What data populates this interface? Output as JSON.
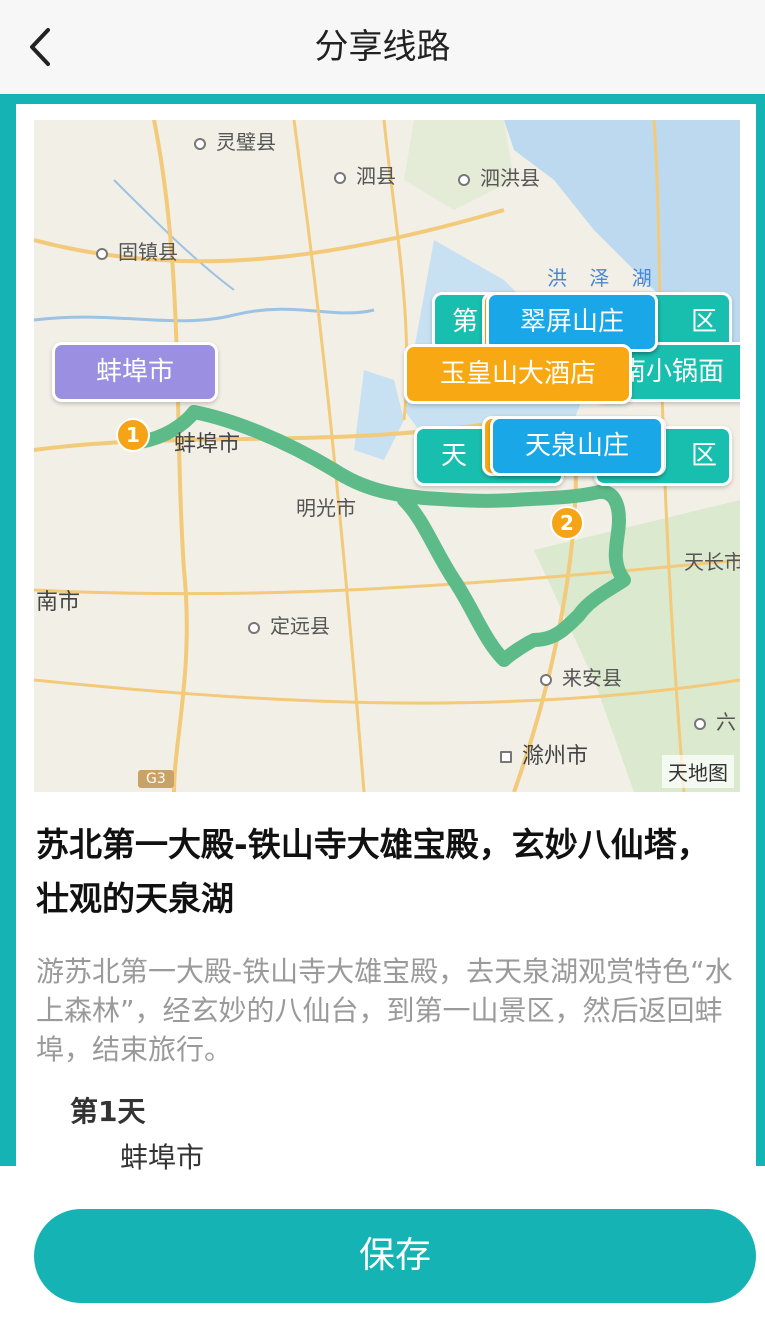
{
  "header": {
    "title": "分享线路"
  },
  "map": {
    "places": {
      "lingbi": "灵璧县",
      "sixian": "泗县",
      "sihong": "泗洪县",
      "guzhen": "固镇县",
      "hongze_lake": "洪 泽 湖",
      "bengbu_map": "蚌埠市",
      "mingguang": "明光市",
      "tianchang": "天长市",
      "huainan": "南市",
      "dingyuan": "定远县",
      "laian": "来安县",
      "chuzhou": "滁州市",
      "liu": "六",
      "g3": "G3"
    },
    "attribution": "天地图",
    "bubbles": {
      "bengbu": "蚌埠市",
      "cuiping": "翠屏山庄",
      "yuhuang": "玉皇山大酒店",
      "tianquan": "天泉山庄",
      "xiaoguomian": "南小锅面",
      "partial_di": "第",
      "partial_qu": "区",
      "partial_tian": "天",
      "partial_qu2": "区"
    },
    "pins": {
      "pin1": "1",
      "pin2": "2"
    },
    "colors": {
      "route": "#5dbb8a",
      "teal": "#19bfae",
      "orange": "#f7a813",
      "blue": "#1aa7e8",
      "purple": "#9a8fe0"
    }
  },
  "route": {
    "title": "苏北第一大殿-铁山寺大雄宝殿，玄妙八仙塔，壮观的天泉湖",
    "description": "游苏北第一大殿-铁山寺大雄宝殿，去天泉湖观赏特色“水上森林”，经玄妙的八仙台，到第一山景区，然后返回蚌埠，结束旅行。",
    "days": [
      {
        "label": "第1天",
        "place": "蚌埠市"
      }
    ]
  },
  "footer": {
    "save_label": "保存"
  },
  "icons": {
    "back": "chevron-left-icon"
  }
}
